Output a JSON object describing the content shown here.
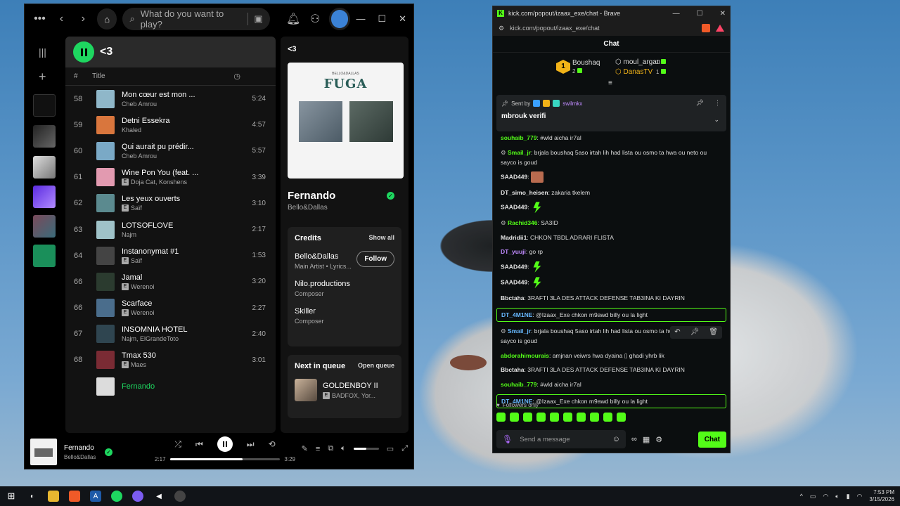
{
  "spotify": {
    "search_placeholder": "What do you want to play?",
    "playlist_title": "<3",
    "col_hash": "#",
    "col_title": "Title",
    "tracks": [
      {
        "num": "58",
        "title": "Mon cœur est mon ...",
        "artist": "Cheb Amrou",
        "explicit": false,
        "duration": "5:24",
        "color": "#8fb7c9"
      },
      {
        "num": "59",
        "title": "Detni Essekra",
        "artist": "Khaled",
        "explicit": false,
        "duration": "4:57",
        "color": "#d9763d"
      },
      {
        "num": "60",
        "title": "Qui aurait pu prédir...",
        "artist": "Cheb Amrou",
        "explicit": false,
        "duration": "5:57",
        "color": "#7aa9c6"
      },
      {
        "num": "61",
        "title": "Wine Pon You (feat. ...",
        "artist": "Doja Cat, Konshens",
        "explicit": true,
        "duration": "3:39",
        "color": "#e29ab0"
      },
      {
        "num": "62",
        "title": "Les yeux ouverts",
        "artist": "Saïf",
        "explicit": true,
        "duration": "3:10",
        "color": "#5b8a8f"
      },
      {
        "num": "63",
        "title": "LOTSOFLOVE",
        "artist": "Najm",
        "explicit": false,
        "duration": "2:17",
        "color": "#9fc2c8"
      },
      {
        "num": "64",
        "title": "Instanonymat #1",
        "artist": "Saïf",
        "explicit": true,
        "duration": "1:53",
        "color": "#444"
      },
      {
        "num": "66",
        "title": "Jamal",
        "artist": "Werenoi",
        "explicit": true,
        "duration": "3:20",
        "color": "#2b3b2f"
      },
      {
        "num": "66",
        "title": "Scarface",
        "artist": "Werenoi",
        "explicit": true,
        "duration": "2:27",
        "color": "#4a6d8c"
      },
      {
        "num": "67",
        "title": "INSOMNIA HOTEL",
        "artist": "Najm, ElGrandeToto",
        "explicit": false,
        "duration": "2:40",
        "color": "#2f4550"
      },
      {
        "num": "68",
        "title": "Tmax 530",
        "artist": "Maes",
        "explicit": true,
        "duration": "3:01",
        "color": "#7a2b34"
      },
      {
        "num": "",
        "title": "Fernando",
        "artist": "",
        "explicit": false,
        "duration": "",
        "color": "#dcdcdc",
        "partial": true
      }
    ],
    "right_title": "<3",
    "cover_title": "FUGA",
    "cover_sub": "BELLO&DALLAS",
    "song_name": "Fernando",
    "song_artist": "Bello&Dallas",
    "credits_label": "Credits",
    "show_all": "Show all",
    "credits": [
      {
        "name": "Bello&Dallas",
        "role": "Main Artist • Lyrics..."
      },
      {
        "name": "Nilo.productions",
        "role": "Composer"
      },
      {
        "name": "Skiller",
        "role": "Composer"
      }
    ],
    "follow_label": "Follow",
    "next_queue": "Next in queue",
    "open_queue": "Open queue",
    "queue_title": "GOLDENBOY II",
    "queue_artist": "BADFOX, Yor...",
    "now_playing_title": "Fernando",
    "now_playing_artist": "Bello&Dallas",
    "elapsed": "2:17",
    "total": "3:29",
    "progress": 0.66,
    "volume": 0.5
  },
  "kick": {
    "window_title": "kick.com/popout/izaax_exe/chat - Brave",
    "url": "kick.com/popout/izaax_exe/chat",
    "chat_header": "Chat",
    "top_rank": "1",
    "top1_name": "Boushaq",
    "top1_count": "2",
    "top2_name": "moul_argan",
    "top2_count": "1",
    "top3_name": "DanasTV",
    "top3_count": "1",
    "pinned_sent_by": "Sent by",
    "pinned_user": "swilmkx",
    "pinned_msg": "mbrouk verifi",
    "messages": [
      {
        "user": "souhaib_779",
        "text": "#wld aicha ir7al",
        "cls": "green"
      },
      {
        "user": "Smail_jr",
        "text": "brjala boushaq 5aso irtah lih had lista ou osmo ta hwa ou neto ou sayco is goud",
        "cls": "green",
        "gear": true
      },
      {
        "user": "SAAD449",
        "text": "",
        "cls": "white",
        "emote": "face"
      },
      {
        "user": "DT_simo_heisen",
        "text": "zakaria tkelem",
        "cls": "white"
      },
      {
        "user": "SAAD449",
        "text": "",
        "cls": "white",
        "emote": "kickgreen"
      },
      {
        "user": "Rachid346",
        "text": "SA3ID",
        "cls": "green",
        "gear": true
      },
      {
        "user": "Madridii1",
        "text": "CHKON TBDL ADRARI FLISTA",
        "cls": "white"
      },
      {
        "user": "DT_yuuji",
        "text": "go rp",
        "cls": "purple"
      },
      {
        "user": "SAAD449",
        "text": "",
        "cls": "white",
        "emote": "kickgreen"
      },
      {
        "user": "SAAD449",
        "text": "",
        "cls": "white",
        "emote": "kickgreen"
      },
      {
        "user": "Bbctaha",
        "text": "3RAFTI 3LA DES ATTACK DEFENSE TAB3INA KI DAYRIN",
        "cls": "white"
      },
      {
        "user": "DT_4M1NE",
        "text": "@Izaax_Exe chkon m9awd billy ou la light",
        "cls": "blue",
        "hl": true
      },
      {
        "user": "Smail_jr",
        "text": "brjala boushaq 5aso irtah lih had lista ou osmo ta hwa ou neto ou sayco is goud",
        "cls": "blue",
        "gear": true,
        "hover": true
      },
      {
        "user": "abdorahimourais",
        "text": "amjnan veiwrs hwa dyaina ▯ ghadi yhrb lik",
        "cls": "green"
      },
      {
        "user": "Bbctaha",
        "text": "3RAFTI 3LA DES ATTACK DEFENSE TAB3INA KI DAYRIN",
        "cls": "white"
      },
      {
        "user": "souhaib_779",
        "text": "#wld aicha ir7al",
        "cls": "green"
      },
      {
        "user": "DT_4M1NE",
        "text": "@Izaax_Exe chkon m9awd billy ou la light",
        "cls": "blue",
        "hl": true
      }
    ],
    "followers_only": "Followers only",
    "input_placeholder": "Send a message",
    "chat_button": "Chat"
  },
  "taskbar": {
    "time": "7:53 PM",
    "date": "3/15/2026"
  }
}
